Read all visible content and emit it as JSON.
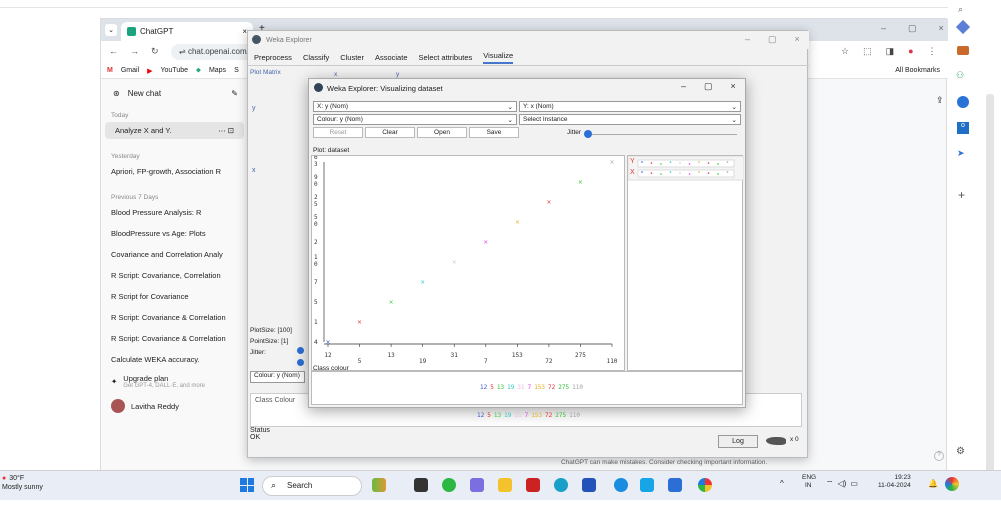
{
  "browser": {
    "tab_title": "ChatGPT",
    "url": "chat.openai.com/",
    "bookmarks": [
      "Gmail",
      "YouTube",
      "Maps",
      "S"
    ],
    "all_bookmarks": "All Bookmarks"
  },
  "chat_sidebar": {
    "new_chat": "New chat",
    "today": "Today",
    "today_items": [
      "Analyze X and Y."
    ],
    "yesterday": "Yesterday",
    "yesterday_items": [
      "Apriori, FP-growth, Association R"
    ],
    "prev7": "Previous 7 Days",
    "prev7_items": [
      "Blood Pressure Analysis: R",
      "BloodPressure vs Age: Plots",
      "Covariance and Correlation Analy",
      "R Script: Covariance, Correlation",
      "R Script for Covariance",
      "R Script: Covariance & Correlation",
      "R Script: Covariance & Correlation",
      "Calculate WEKA accuracy."
    ],
    "upgrade": "Upgrade plan",
    "upgrade_sub": "Get GPT-4, DALL·E, and more",
    "user": "Lavitha Reddy"
  },
  "chatgpt_footer": "ChatGPT can make mistakes. Consider checking important information.",
  "weka": {
    "title": "Weka Explorer",
    "tabs": [
      "Preprocess",
      "Classify",
      "Cluster",
      "Associate",
      "Select attributes",
      "Visualize"
    ],
    "plot_matrix": "Plot Matrix",
    "matrix_x": "x",
    "matrix_y": "y",
    "plotsize": "PlotSize: [100]",
    "pointsize": "PointSize: [1]",
    "jitter": "Jitter:",
    "colour": "Colour: y (Nom)",
    "class_colour": "Class Colour",
    "status_label": "Status",
    "status": "OK",
    "log": "Log",
    "x0": "x 0"
  },
  "dialog": {
    "title": "Weka Explorer: Visualizing dataset",
    "x_axis": "X: y (Nom)",
    "y_axis": "Y: x (Nom)",
    "colour": "Colour: y (Nom)",
    "select_instance": "Select Instance",
    "buttons": [
      "Reset",
      "Clear",
      "Open",
      "Save"
    ],
    "jitter": "Jitter",
    "plot_title": "Plot: dataset",
    "class_colour": "Class colour",
    "legend_labels": [
      "Y",
      "X"
    ]
  },
  "chart_data": {
    "type": "scatter",
    "x_categories": [
      "12",
      "5",
      "13",
      "19",
      "31",
      "7",
      "153",
      "72",
      "275",
      "110"
    ],
    "y_categories": [
      "4",
      "1",
      "5",
      "7",
      "1 0",
      "2",
      "5 0",
      "2 5",
      "9 0",
      "6 3"
    ],
    "points": [
      {
        "x": "12",
        "y": "4",
        "color": "#3355cc"
      },
      {
        "x": "5",
        "y": "1",
        "color": "#e03030"
      },
      {
        "x": "13",
        "y": "5",
        "color": "#33cc33"
      },
      {
        "x": "19",
        "y": "7",
        "color": "#30c8c8"
      },
      {
        "x": "31",
        "y": "1 0",
        "color": "#e0c0e0"
      },
      {
        "x": "7",
        "y": "2",
        "color": "#e040e0"
      },
      {
        "x": "153",
        "y": "5 0",
        "color": "#e0b020"
      },
      {
        "x": "72",
        "y": "2 5",
        "color": "#e03030"
      },
      {
        "x": "275",
        "y": "9 0",
        "color": "#30c030"
      },
      {
        "x": "110",
        "y": "6 3",
        "color": "#a0a0a0"
      }
    ],
    "class_colours": [
      {
        "label": "12",
        "color": "#3355cc"
      },
      {
        "label": "5",
        "color": "#e03030"
      },
      {
        "label": "13",
        "color": "#33cc33"
      },
      {
        "label": "19",
        "color": "#30c8c8"
      },
      {
        "label": "31",
        "color": "#e0c0e0"
      },
      {
        "label": "7",
        "color": "#e040e0"
      },
      {
        "label": "153",
        "color": "#e0b020"
      },
      {
        "label": "72",
        "color": "#e03030"
      },
      {
        "label": "275",
        "color": "#30c030"
      },
      {
        "label": "110",
        "color": "#a0a0a0"
      }
    ]
  },
  "taskbar": {
    "temp": "30°F",
    "weather": "Mostly sunny",
    "search": "Search",
    "lang1": "ENG",
    "lang2": "IN",
    "time": "19:23",
    "date": "11-04-2024"
  }
}
